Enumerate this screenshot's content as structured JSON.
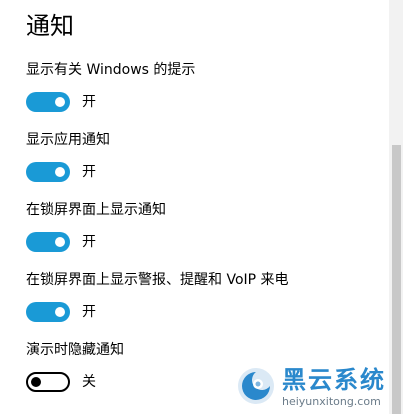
{
  "section": {
    "title": "通知"
  },
  "settings": [
    {
      "label": "显示有关 Windows 的提示",
      "state": "开",
      "on": true
    },
    {
      "label": "显示应用通知",
      "state": "开",
      "on": true
    },
    {
      "label": "在锁屏界面上显示通知",
      "state": "开",
      "on": true
    },
    {
      "label": "在锁屏界面上显示警报、提醒和 VoIP 来电",
      "state": "开",
      "on": true
    },
    {
      "label": "演示时隐藏通知",
      "state": "关",
      "on": false
    }
  ],
  "watermark": {
    "title": "黑云系统",
    "url": "heiyunxitong.com"
  },
  "colors": {
    "accent": "#1a9ad6",
    "watermark": "#2a88cc"
  }
}
